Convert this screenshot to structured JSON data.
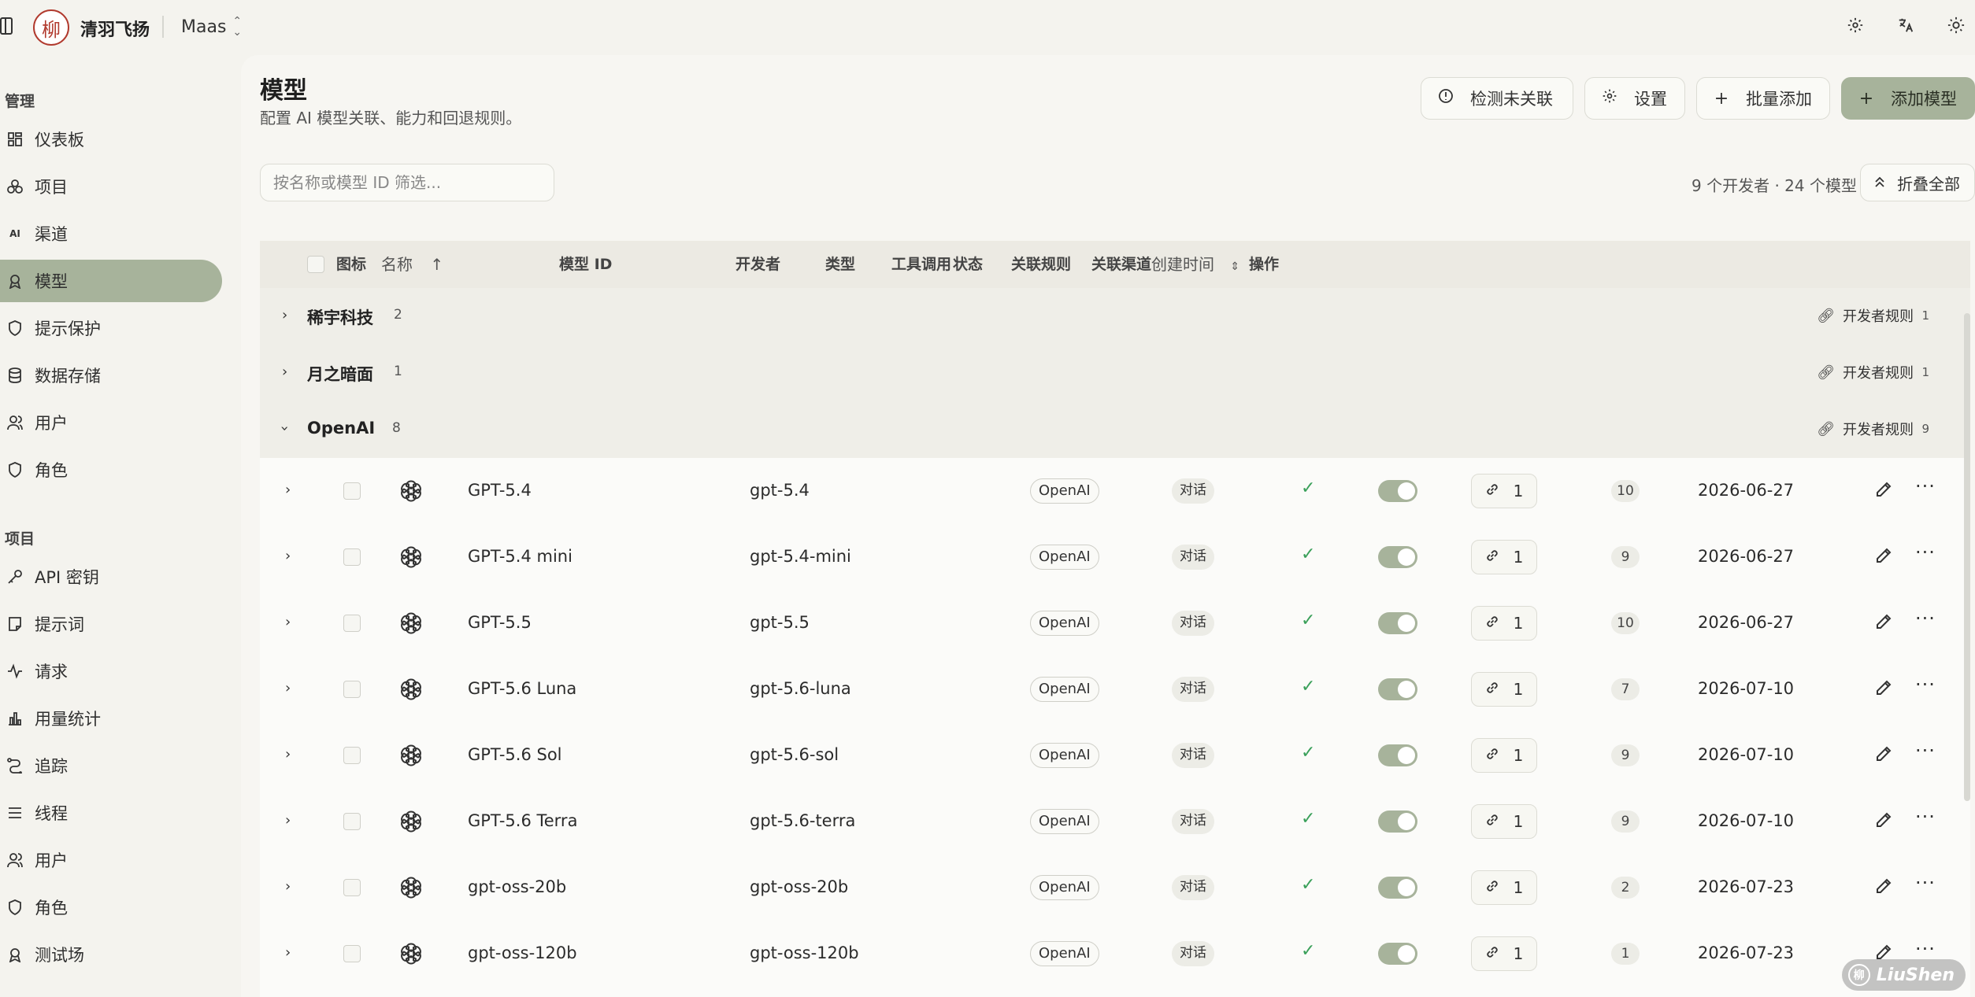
{
  "app": {
    "org_name": "清羽飞扬",
    "project": "Maas",
    "logo_char": "柳"
  },
  "sidebar": {
    "sections": [
      {
        "title": "管理",
        "items": [
          {
            "label": "仪表板",
            "icon": "dashboard-icon"
          },
          {
            "label": "项目",
            "icon": "projects-icon"
          },
          {
            "label": "渠道",
            "icon": "ai-channel-icon"
          },
          {
            "label": "模型",
            "icon": "model-icon",
            "active": true
          },
          {
            "label": "提示保护",
            "icon": "shield-icon"
          },
          {
            "label": "数据存储",
            "icon": "database-icon"
          },
          {
            "label": "用户",
            "icon": "users-icon"
          },
          {
            "label": "角色",
            "icon": "shield-icon"
          }
        ]
      },
      {
        "title": "项目",
        "items": [
          {
            "label": "API 密钥",
            "icon": "key-icon"
          },
          {
            "label": "提示词",
            "icon": "note-icon"
          },
          {
            "label": "请求",
            "icon": "activity-icon"
          },
          {
            "label": "用量统计",
            "icon": "bar-chart-icon"
          },
          {
            "label": "追踪",
            "icon": "trace-icon"
          },
          {
            "label": "线程",
            "icon": "list-icon"
          },
          {
            "label": "用户",
            "icon": "users-icon"
          },
          {
            "label": "角色",
            "icon": "shield-icon"
          },
          {
            "label": "测试场",
            "icon": "playground-icon"
          }
        ]
      }
    ]
  },
  "header": {
    "title": "模型",
    "subtitle": "配置 AI 模型关联、能力和回退规则。",
    "buttons": {
      "detect": "检测未关联",
      "settings": "设置",
      "batch_add": "批量添加",
      "add_model": "添加模型"
    }
  },
  "toolbar": {
    "search_placeholder": "按名称或模型 ID 筛选...",
    "summary": "9 个开发者 · 24 个模型",
    "collapse_all": "折叠全部"
  },
  "table": {
    "columns": {
      "icon": "图标",
      "name": "名称",
      "model_id": "模型 ID",
      "developer": "开发者",
      "type": "类型",
      "tool_call": "工具调用",
      "status": "状态",
      "rules": "关联规则",
      "channels": "关联渠道",
      "created": "创建时间",
      "actions": "操作"
    },
    "groups": [
      {
        "name": "稀宇科技",
        "count": "2",
        "expanded": false,
        "rule_label": "开发者规则",
        "rule_count": "1"
      },
      {
        "name": "月之暗面",
        "count": "1",
        "expanded": false,
        "rule_label": "开发者规则",
        "rule_count": "1"
      },
      {
        "name": "OpenAI",
        "count": "8",
        "expanded": true,
        "rule_label": "开发者规则",
        "rule_count": "9"
      }
    ],
    "rows": [
      {
        "name": "GPT-5.4",
        "model_id": "gpt-5.4",
        "developer": "OpenAI",
        "type": "对话",
        "tool_call": true,
        "enabled": true,
        "rules": "1",
        "channels": "10",
        "created": "2026-06-27"
      },
      {
        "name": "GPT-5.4 mini",
        "model_id": "gpt-5.4-mini",
        "developer": "OpenAI",
        "type": "对话",
        "tool_call": true,
        "enabled": true,
        "rules": "1",
        "channels": "9",
        "created": "2026-06-27"
      },
      {
        "name": "GPT-5.5",
        "model_id": "gpt-5.5",
        "developer": "OpenAI",
        "type": "对话",
        "tool_call": true,
        "enabled": true,
        "rules": "1",
        "channels": "10",
        "created": "2026-06-27"
      },
      {
        "name": "GPT-5.6 Luna",
        "model_id": "gpt-5.6-luna",
        "developer": "OpenAI",
        "type": "对话",
        "tool_call": true,
        "enabled": true,
        "rules": "1",
        "channels": "7",
        "created": "2026-07-10"
      },
      {
        "name": "GPT-5.6 Sol",
        "model_id": "gpt-5.6-sol",
        "developer": "OpenAI",
        "type": "对话",
        "tool_call": true,
        "enabled": true,
        "rules": "1",
        "channels": "9",
        "created": "2026-07-10"
      },
      {
        "name": "GPT-5.6 Terra",
        "model_id": "gpt-5.6-terra",
        "developer": "OpenAI",
        "type": "对话",
        "tool_call": true,
        "enabled": true,
        "rules": "1",
        "channels": "9",
        "created": "2026-07-10"
      },
      {
        "name": "gpt-oss-20b",
        "model_id": "gpt-oss-20b",
        "developer": "OpenAI",
        "type": "对话",
        "tool_call": true,
        "enabled": true,
        "rules": "1",
        "channels": "2",
        "created": "2026-07-23"
      },
      {
        "name": "gpt-oss-120b",
        "model_id": "gpt-oss-120b",
        "developer": "OpenAI",
        "type": "对话",
        "tool_call": true,
        "enabled": true,
        "rules": "1",
        "channels": "1",
        "created": "2026-07-23"
      }
    ]
  },
  "watermark": {
    "text": "LiuShen",
    "char": "柳"
  },
  "colors": {
    "accent": "#a7b39b",
    "check": "#3aa05a",
    "background": "#f4f3ee"
  }
}
